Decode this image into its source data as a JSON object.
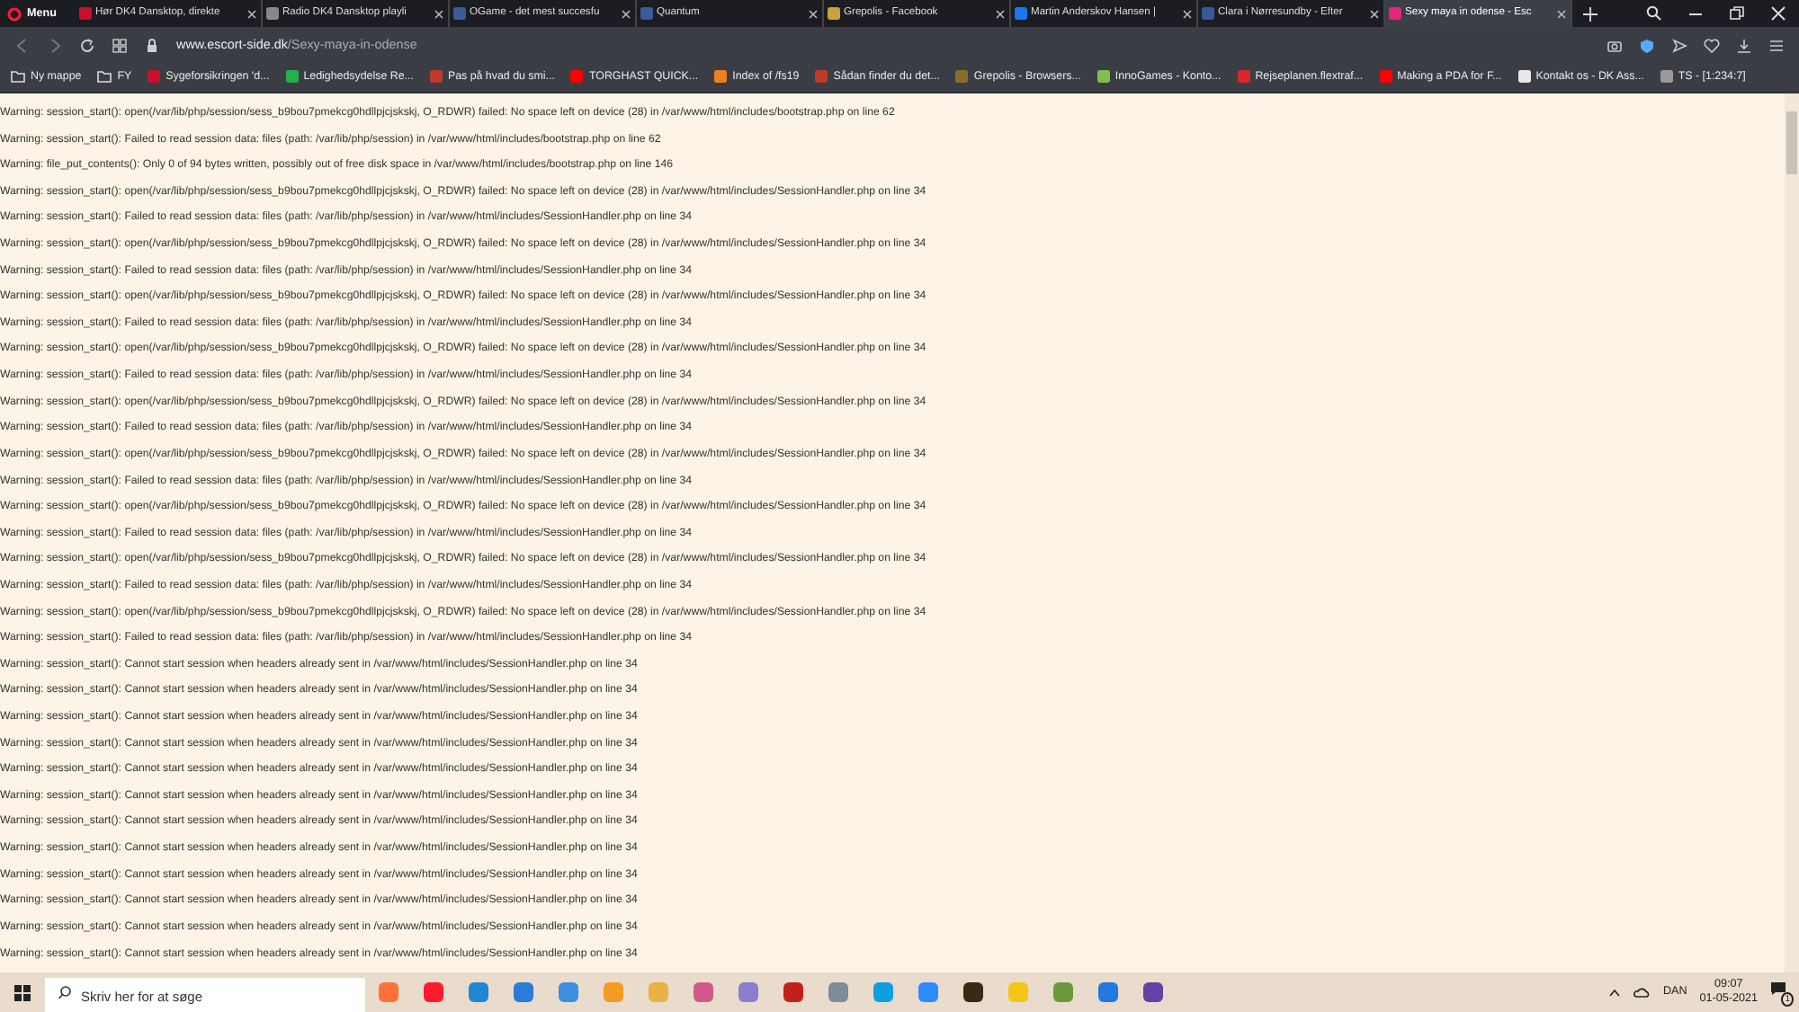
{
  "browser": {
    "menu_label": "Menu",
    "tabs": [
      {
        "title": "Hør DK4 Dansktop, direkte",
        "selected": false
      },
      {
        "title": "Radio DK4 Dansktop playli",
        "selected": false
      },
      {
        "title": "OGame - det mest succesfu",
        "selected": false
      },
      {
        "title": "Quantum",
        "selected": false
      },
      {
        "title": "Grepolis - Facebook",
        "selected": false
      },
      {
        "title": "Martin Anderskov Hansen |",
        "selected": false
      },
      {
        "title": "Clara i Nørresundby - Efter",
        "selected": false
      },
      {
        "title": "Sexy maya in odense - Esc",
        "selected": true
      }
    ],
    "address": {
      "domain": "www.escort-side.dk",
      "path": "/Sexy-maya-in-odense"
    },
    "bookmarks": [
      {
        "label": "Ny mappe",
        "kind": "folder"
      },
      {
        "label": "FY",
        "kind": "folder"
      },
      {
        "label": "Sygeforsikringen 'd...",
        "kind": "site",
        "color": "#c8102e"
      },
      {
        "label": "Ledighedsydelse Re...",
        "kind": "site",
        "color": "#22b14c"
      },
      {
        "label": "Pas på hvad du smi...",
        "kind": "site",
        "color": "#c0392b"
      },
      {
        "label": "TORGHAST QUICK...",
        "kind": "site",
        "color": "#ff0000"
      },
      {
        "label": "Index of /fs19",
        "kind": "site",
        "color": "#f07f1d"
      },
      {
        "label": "Sådan finder du det...",
        "kind": "site",
        "color": "#c0392b"
      },
      {
        "label": "Grepolis - Browsers...",
        "kind": "site",
        "color": "#8a6d2b"
      },
      {
        "label": "InnoGames - Konto...",
        "kind": "site",
        "color": "#7fbf4d"
      },
      {
        "label": "Rejseplanen.flextraf...",
        "kind": "site",
        "color": "#d9262b"
      },
      {
        "label": "Making a PDA for F...",
        "kind": "site",
        "color": "#ff0000"
      },
      {
        "label": "Kontakt os - DK Ass...",
        "kind": "site",
        "color": "#e8e8e8"
      },
      {
        "label": "TS - [1:234:7]",
        "kind": "site",
        "color": "#9a9a9a"
      }
    ]
  },
  "page": {
    "warnings": [
      "Warning: session_start(): open(/var/lib/php/session/sess_b9bou7pmekcg0hdllpjcjskskj, O_RDWR) failed: No space left on device (28) in /var/www/html/includes/bootstrap.php on line 62",
      "Warning: session_start(): Failed to read session data: files (path: /var/lib/php/session) in /var/www/html/includes/bootstrap.php on line 62",
      "Warning: file_put_contents(): Only 0 of 94 bytes written, possibly out of free disk space in /var/www/html/includes/bootstrap.php on line 146",
      "Warning: session_start(): open(/var/lib/php/session/sess_b9bou7pmekcg0hdllpjcjskskj, O_RDWR) failed: No space left on device (28) in /var/www/html/includes/SessionHandler.php on line 34",
      "Warning: session_start(): Failed to read session data: files (path: /var/lib/php/session) in /var/www/html/includes/SessionHandler.php on line 34",
      "Warning: session_start(): open(/var/lib/php/session/sess_b9bou7pmekcg0hdllpjcjskskj, O_RDWR) failed: No space left on device (28) in /var/www/html/includes/SessionHandler.php on line 34",
      "Warning: session_start(): Failed to read session data: files (path: /var/lib/php/session) in /var/www/html/includes/SessionHandler.php on line 34",
      "Warning: session_start(): open(/var/lib/php/session/sess_b9bou7pmekcg0hdllpjcjskskj, O_RDWR) failed: No space left on device (28) in /var/www/html/includes/SessionHandler.php on line 34",
      "Warning: session_start(): Failed to read session data: files (path: /var/lib/php/session) in /var/www/html/includes/SessionHandler.php on line 34",
      "Warning: session_start(): open(/var/lib/php/session/sess_b9bou7pmekcg0hdllpjcjskskj, O_RDWR) failed: No space left on device (28) in /var/www/html/includes/SessionHandler.php on line 34",
      "Warning: session_start(): Failed to read session data: files (path: /var/lib/php/session) in /var/www/html/includes/SessionHandler.php on line 34",
      "Warning: session_start(): open(/var/lib/php/session/sess_b9bou7pmekcg0hdllpjcjskskj, O_RDWR) failed: No space left on device (28) in /var/www/html/includes/SessionHandler.php on line 34",
      "Warning: session_start(): Failed to read session data: files (path: /var/lib/php/session) in /var/www/html/includes/SessionHandler.php on line 34",
      "Warning: session_start(): open(/var/lib/php/session/sess_b9bou7pmekcg0hdllpjcjskskj, O_RDWR) failed: No space left on device (28) in /var/www/html/includes/SessionHandler.php on line 34",
      "Warning: session_start(): Failed to read session data: files (path: /var/lib/php/session) in /var/www/html/includes/SessionHandler.php on line 34",
      "Warning: session_start(): open(/var/lib/php/session/sess_b9bou7pmekcg0hdllpjcjskskj, O_RDWR) failed: No space left on device (28) in /var/www/html/includes/SessionHandler.php on line 34",
      "Warning: session_start(): Failed to read session data: files (path: /var/lib/php/session) in /var/www/html/includes/SessionHandler.php on line 34",
      "Warning: session_start(): open(/var/lib/php/session/sess_b9bou7pmekcg0hdllpjcjskskj, O_RDWR) failed: No space left on device (28) in /var/www/html/includes/SessionHandler.php on line 34",
      "Warning: session_start(): Failed to read session data: files (path: /var/lib/php/session) in /var/www/html/includes/SessionHandler.php on line 34",
      "Warning: session_start(): open(/var/lib/php/session/sess_b9bou7pmekcg0hdllpjcjskskj, O_RDWR) failed: No space left on device (28) in /var/www/html/includes/SessionHandler.php on line 34",
      "Warning: session_start(): Failed to read session data: files (path: /var/lib/php/session) in /var/www/html/includes/SessionHandler.php on line 34",
      "Warning: session_start(): Cannot start session when headers already sent in /var/www/html/includes/SessionHandler.php on line 34",
      "Warning: session_start(): Cannot start session when headers already sent in /var/www/html/includes/SessionHandler.php on line 34",
      "Warning: session_start(): Cannot start session when headers already sent in /var/www/html/includes/SessionHandler.php on line 34",
      "Warning: session_start(): Cannot start session when headers already sent in /var/www/html/includes/SessionHandler.php on line 34",
      "Warning: session_start(): Cannot start session when headers already sent in /var/www/html/includes/SessionHandler.php on line 34",
      "Warning: session_start(): Cannot start session when headers already sent in /var/www/html/includes/SessionHandler.php on line 34",
      "Warning: session_start(): Cannot start session when headers already sent in /var/www/html/includes/SessionHandler.php on line 34",
      "Warning: session_start(): Cannot start session when headers already sent in /var/www/html/includes/SessionHandler.php on line 34",
      "Warning: session_start(): Cannot start session when headers already sent in /var/www/html/includes/SessionHandler.php on line 34",
      "Warning: session_start(): Cannot start session when headers already sent in /var/www/html/includes/SessionHandler.php on line 34",
      "Warning: session_start(): Cannot start session when headers already sent in /var/www/html/includes/SessionHandler.php on line 34",
      "Warning: session_start(): Cannot start session when headers already sent in /var/www/html/includes/SessionHandler.php on line 34"
    ]
  },
  "taskbar": {
    "search": {
      "placeholder": "Skriv her for at søge"
    },
    "language": "DAN",
    "time": "09:07",
    "date": "01-05-2021",
    "notification_count": "1"
  }
}
